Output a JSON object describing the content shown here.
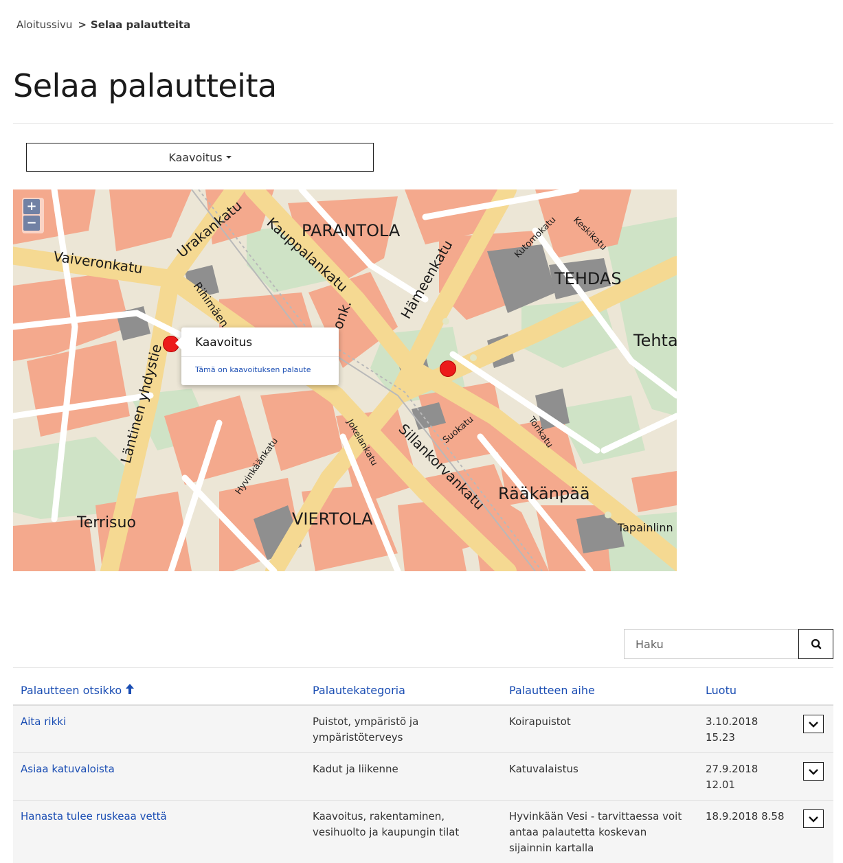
{
  "breadcrumb": {
    "home": "Aloitussivu",
    "separator": ">",
    "current": "Selaa palautteita"
  },
  "page_title": "Selaa palautteita",
  "filter": {
    "label": "Kaavoitus"
  },
  "map": {
    "zoom_in": "+",
    "zoom_out": "−",
    "labels": {
      "parantola": "PARANTOLA",
      "tehdas": "TEHDAS",
      "tehtaa": "Tehta",
      "terrisuo": "Terrisuo",
      "viertola": "VIERTOLA",
      "raakanpaa": "Rääkänpää",
      "tapainlinna": "Tapainlinn",
      "urakankatu": "Urakankatu",
      "vaiveronkatu": "Vaiveronkatu",
      "kauppalankatu": "Kauppalankatu",
      "hameenkatu": "Hämeenkatu",
      "lantinenyhdystie": "Läntinen yhdystie",
      "sillankorvankatu": "Sillankorvankatu",
      "rihimaen": "Rihimäen",
      "jokelankatu": "Jokelankatu",
      "suokatu": "Suokatu",
      "torikatu": "Torikatu",
      "kutomokatu": "Kutomokatu",
      "keskikatu": "Keskikatu",
      "hyvinkaankatu": "Hyvinkäänkatu",
      "ronk": "onk."
    },
    "popup": {
      "title": "Kaavoitus",
      "text": "Tämä on kaavoituksen palaute"
    }
  },
  "search": {
    "placeholder": "Haku",
    "icon": "search-icon"
  },
  "table": {
    "headers": {
      "title": "Palautteen otsikko",
      "category": "Palautekategoria",
      "subject": "Palautteen aihe",
      "created": "Luotu"
    },
    "rows": [
      {
        "title": "Aita rikki",
        "category": "Puistot, ympäristö ja ympäristöterveys",
        "subject": "Koirapuistot",
        "created": "3.10.2018 15.23"
      },
      {
        "title": "Asiaa katuvaloista",
        "category": "Kadut ja liikenne",
        "subject": "Katuvalaistus",
        "created": "27.9.2018 12.01"
      },
      {
        "title": "Hanasta tulee ruskeaa vettä",
        "category": "Kaavoitus, rakentaminen, vesihuolto ja kaupungin tilat",
        "subject": "Hyvinkään Vesi - tarvittaessa voit antaa palautetta koskevan sijainnin kartalla",
        "created": "18.9.2018 8.58"
      }
    ]
  },
  "colors": {
    "link": "#1a4db3",
    "marker": "#ec1b1b",
    "road": "#f7dea0",
    "block": "#f4a88c",
    "park": "#cde3c8",
    "building": "#8a8a8a"
  }
}
